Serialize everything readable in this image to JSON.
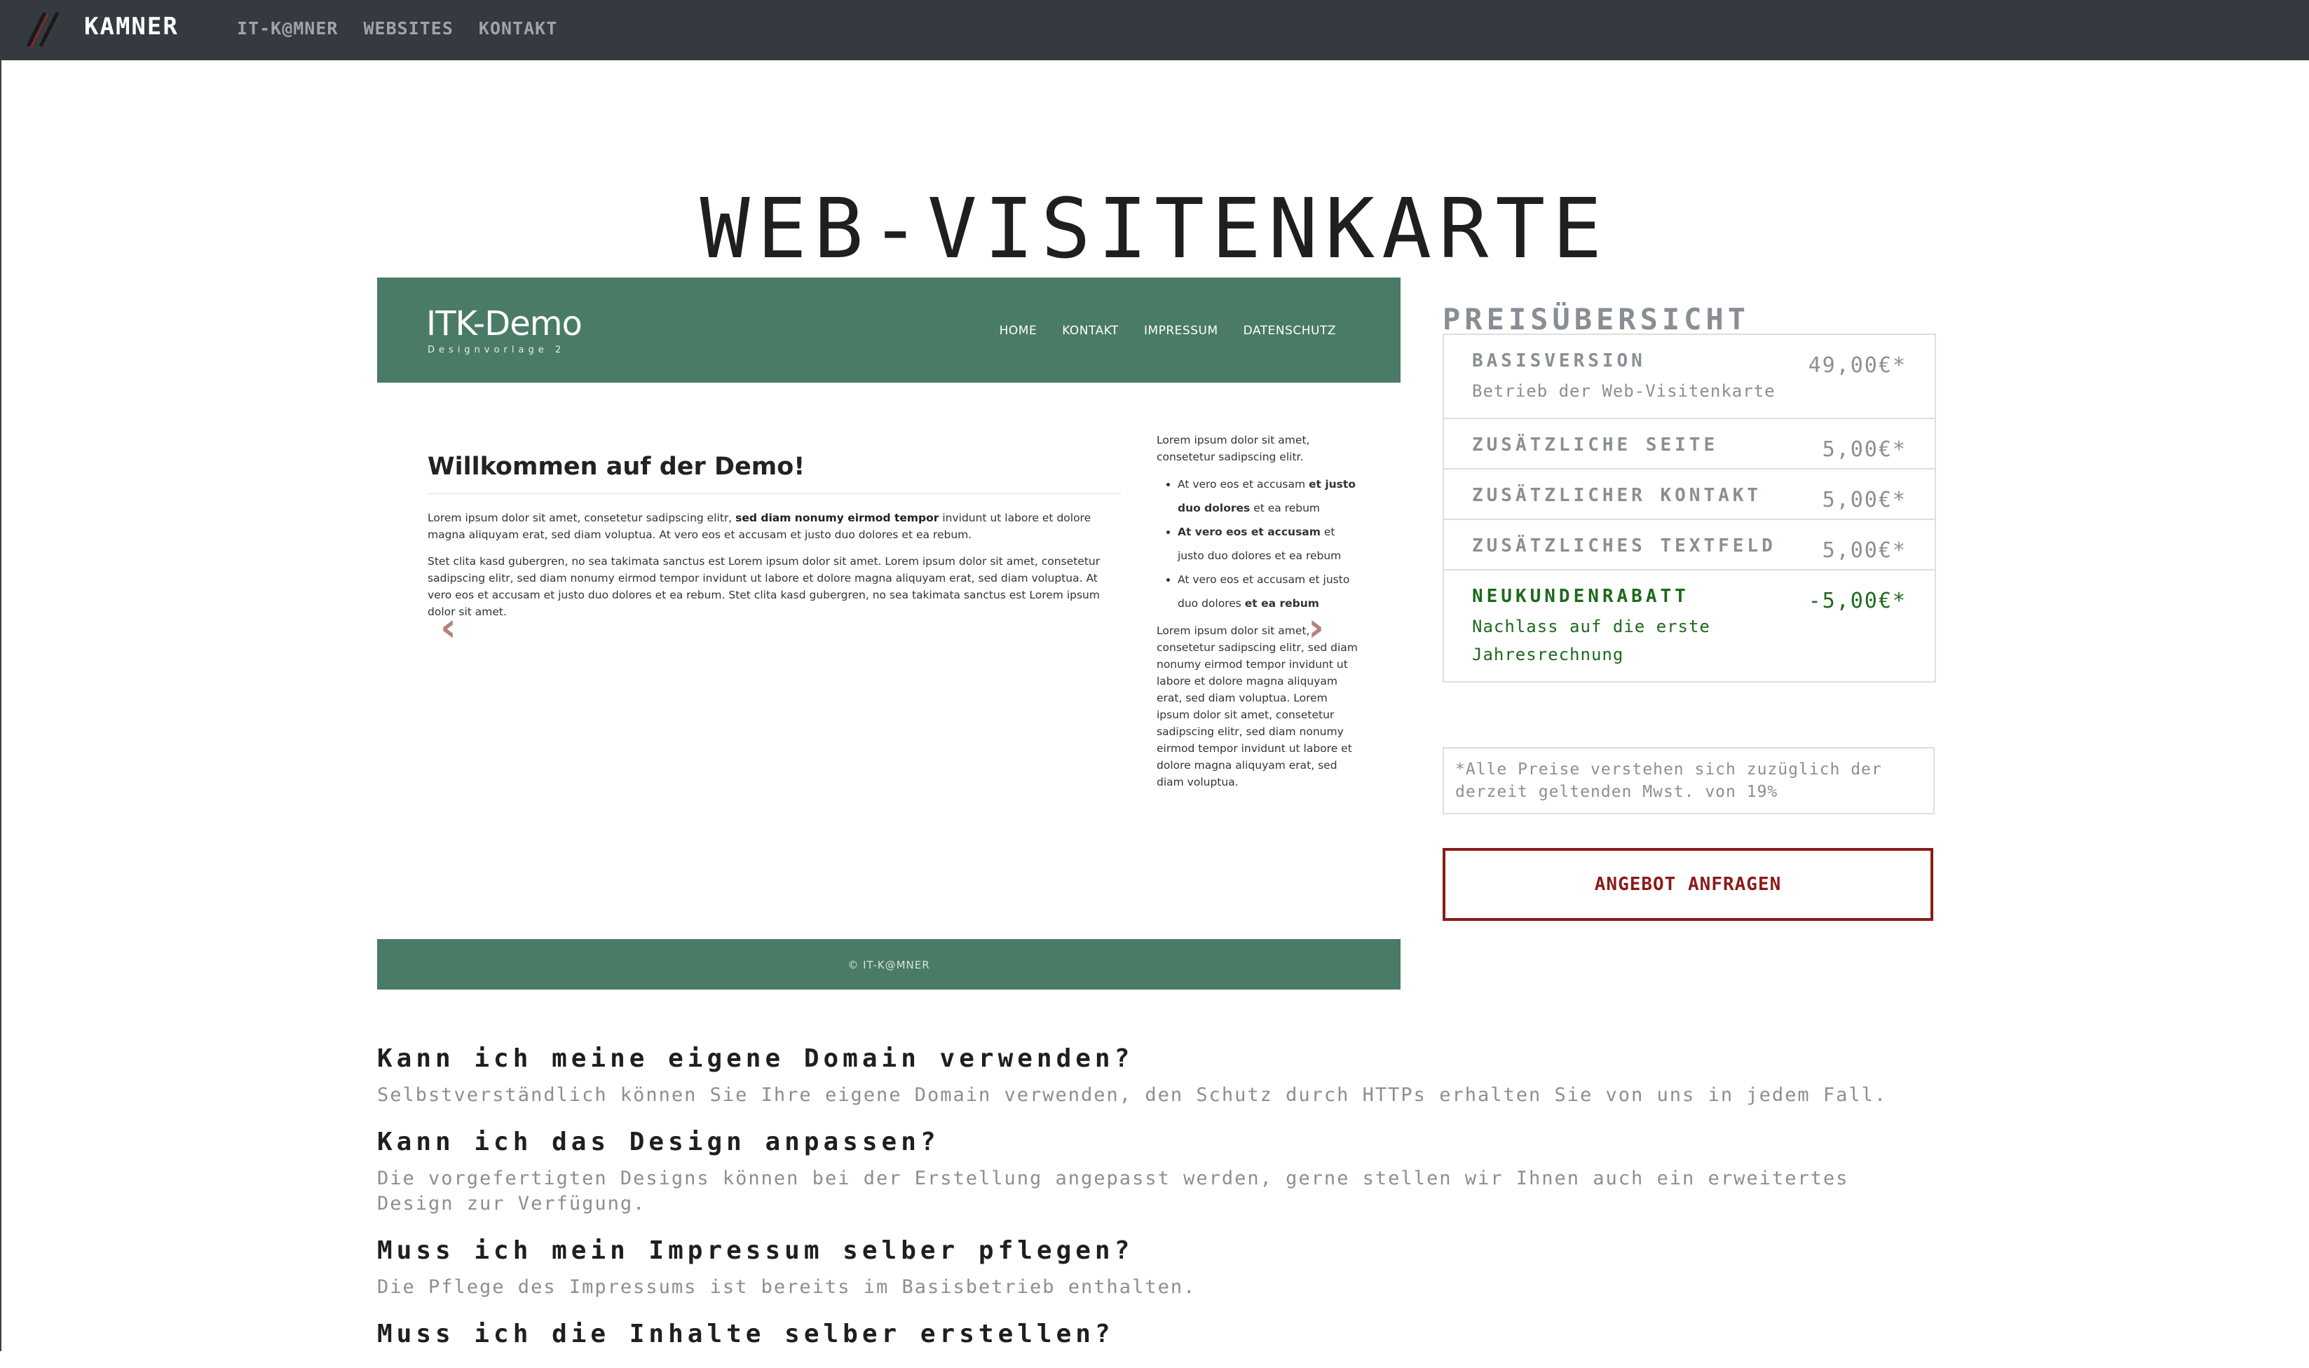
{
  "navbar": {
    "brand": "KAMNER",
    "links": [
      "IT-K@MNER",
      "WEBSITES",
      "KONTAKT"
    ],
    "background": "#343a40"
  },
  "page": {
    "title": "WEB-VISITENKARTE"
  },
  "preview": {
    "logo": "ITK-Demo",
    "logo_sub": "Designvorlage 2",
    "nav": [
      "HOME",
      "KONTAKT",
      "IMPRESSUM",
      "DATENSCHUTZ"
    ],
    "heading": "Willkommen auf der Demo!",
    "para1_pre": "Lorem ipsum dolor sit amet, consetetur sadipscing elitr, ",
    "para1_bold": "sed diam nonumy eirmod tempor",
    "para1_post": " invidunt ut labore et dolore magna aliquyam erat, sed diam voluptua. At vero eos et accusam et justo duo dolores et ea rebum.",
    "para2": "Stet clita kasd gubergren, no sea takimata sanctus est Lorem ipsum dolor sit amet. Lorem ipsum dolor sit amet, consetetur sadipscing elitr, sed diam nonumy eirmod tempor invidunt ut labore et dolore magna aliquyam erat, sed diam voluptua. At vero eos et accusam et justo duo dolores et ea rebum. Stet clita kasd gubergren, no sea takimata sanctus est Lorem ipsum dolor sit amet.",
    "aside_intro": "Lorem ipsum dolor sit amet, consetetur sadipscing elitr.",
    "aside_list": [
      {
        "pre": "At vero eos et accusam ",
        "bold": "et justo duo dolores",
        "post": " et ea rebum"
      },
      {
        "pre": "",
        "bold": "At vero eos et accusam",
        "post": " et justo duo dolores et ea rebum"
      },
      {
        "pre": "At vero eos et accusam et justo duo dolores ",
        "bold": "et ea rebum",
        "post": ""
      }
    ],
    "aside_outro": "Lorem ipsum dolor sit amet, consetetur sadipscing elitr, sed diam nonumy eirmod tempor invidunt ut labore et dolore magna aliquyam erat, sed diam voluptua. Lorem ipsum dolor sit amet, consetetur sadipscing elitr, sed diam nonumy eirmod tempor invidunt ut labore et dolore magna aliquyam erat, sed diam voluptua.",
    "footer": "© IT-K@MNER",
    "prev_arrow": "‹",
    "next_arrow": "›",
    "green": "#4a7b66",
    "arrow_color": "#b8807a"
  },
  "prices": {
    "heading": "PREISÜBERSICHT",
    "rows": [
      {
        "title": "BASISVERSION",
        "sub": "Betrieb der Web-Visitenkarte",
        "amount": "49,00€*"
      },
      {
        "title": "ZUSÄTZLICHE SEITE",
        "sub": "",
        "amount": "5,00€*"
      },
      {
        "title": "ZUSÄTZLICHER KONTAKT",
        "sub": "",
        "amount": "5,00€*"
      },
      {
        "title": "ZUSÄTZLICHES TEXTFELD",
        "sub": "",
        "amount": "5,00€*"
      }
    ],
    "discount": {
      "title": "NEUKUNDENRABATT",
      "sub": "Nachlass auf die erste Jahresrechnung",
      "amount": "-5,00€*",
      "color": "#1d6a1d"
    },
    "vat_note": "*Alle Preise verstehen sich zuzüglich der derzeit geltenden Mwst. von 19%",
    "cta": "ANGEBOT ANFRAGEN",
    "cta_color": "#8b1a1a"
  },
  "faq": [
    {
      "q": "Kann ich meine eigene Domain verwenden?",
      "a": "Selbstverständlich können Sie Ihre eigene Domain verwenden, den Schutz durch HTTPs erhalten Sie von uns in jedem Fall."
    },
    {
      "q": "Kann ich das Design anpassen?",
      "a": "Die vorgefertigten Designs können bei der Erstellung angepasst werden, gerne stellen wir Ihnen auch ein erweitertes Design zur Verfügung."
    },
    {
      "q": "Muss ich mein Impressum selber pflegen?",
      "a": "Die Pflege des Impressums ist bereits im Basisbetrieb enthalten."
    },
    {
      "q": "Muss ich die Inhalte selber erstellen?",
      "a": ""
    }
  ]
}
